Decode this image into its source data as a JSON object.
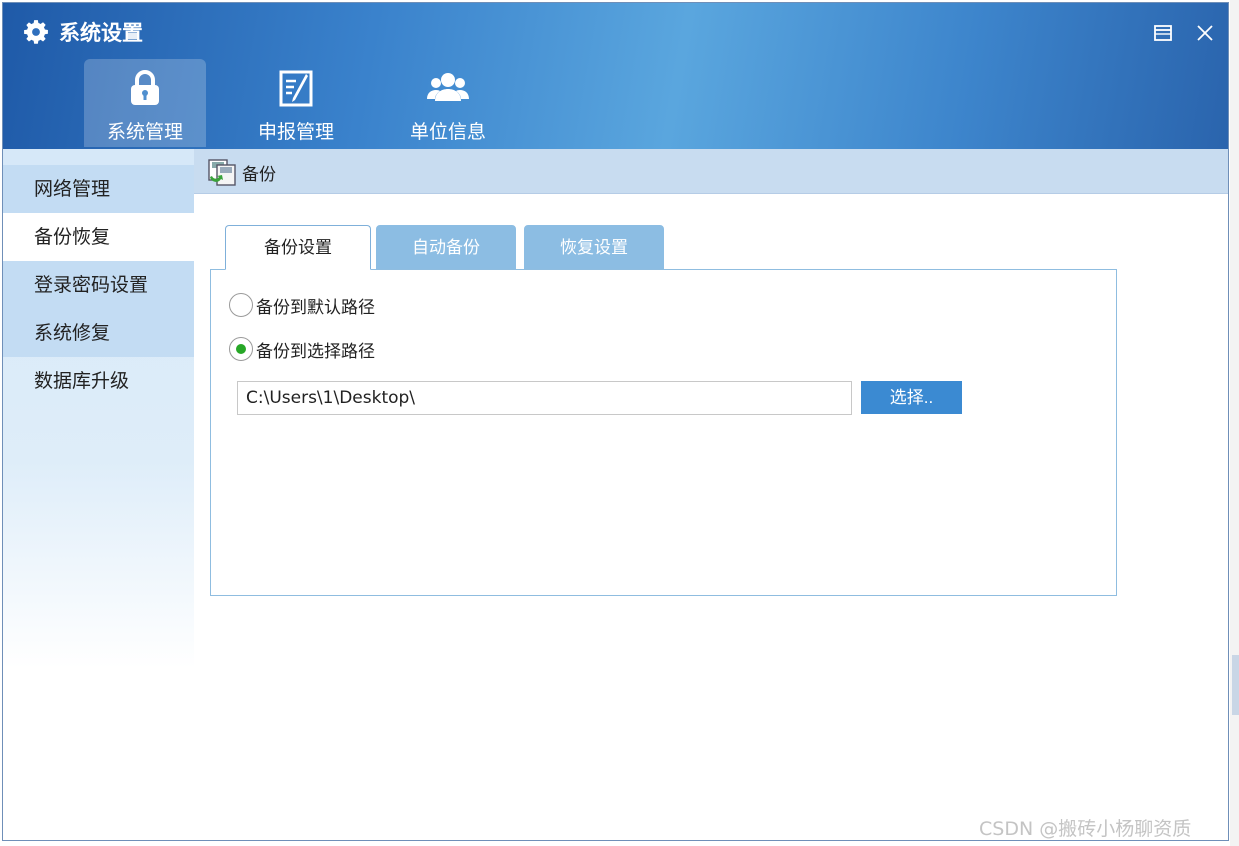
{
  "window": {
    "title": "系统设置",
    "title_icon": "gear-icon",
    "restore_icon": "restore-window-icon",
    "close_icon": "close-icon"
  },
  "top_nav": [
    {
      "label": "系统管理",
      "icon": "lock-icon",
      "active": true
    },
    {
      "label": "申报管理",
      "icon": "edit-document-icon",
      "active": false
    },
    {
      "label": "单位信息",
      "icon": "users-icon",
      "active": false
    }
  ],
  "sidebar": {
    "items": [
      {
        "label": "网络管理"
      },
      {
        "label": "备份恢复",
        "active": true
      },
      {
        "label": "登录密码设置"
      },
      {
        "label": "系统修复"
      },
      {
        "label": "数据库升级"
      }
    ]
  },
  "content_header": {
    "title": "备份",
    "icon": "backup-icon"
  },
  "tabs": [
    {
      "label": "备份设置",
      "active": true
    },
    {
      "label": "自动备份",
      "active": false
    },
    {
      "label": "恢复设置",
      "active": false
    }
  ],
  "backup": {
    "options": [
      {
        "label": "备份到默认路径",
        "selected": false
      },
      {
        "label": "备份到选择路径",
        "selected": true
      }
    ],
    "path_value": "C:\\Users\\1\\Desktop\\",
    "choose_label": "选择.."
  },
  "watermark": "CSDN @搬砖小杨聊资质",
  "colors": {
    "title_bar": "#3a82cc",
    "selected_radio": "#27a727",
    "choose_button": "#3b8ad2",
    "inactive_tab": "#8cbde3",
    "header_band": "#c8dcf0"
  }
}
